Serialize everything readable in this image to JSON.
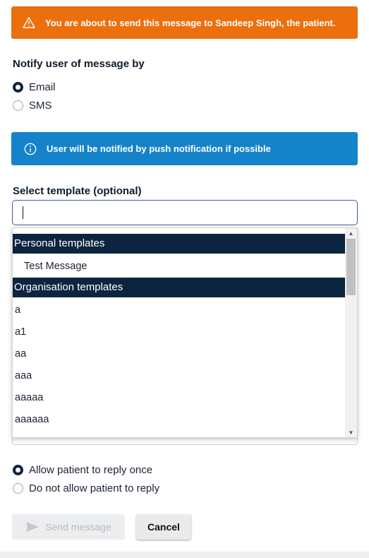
{
  "warning": {
    "text": "You are about to send this message to Sandeep Singh, the patient.",
    "icon": "warning-triangle-icon"
  },
  "notify": {
    "heading": "Notify user of message by",
    "options": [
      {
        "label": "Email",
        "selected": true
      },
      {
        "label": "SMS",
        "selected": false
      }
    ]
  },
  "info": {
    "text": "User will be notified by push notification if possible",
    "icon": "info-circle-icon"
  },
  "template": {
    "heading": "Select template (optional)",
    "input_value": "",
    "groups": [
      {
        "label": "Personal templates",
        "items": [
          "Test Message"
        ]
      },
      {
        "label": "Organisation templates",
        "items": [
          "a",
          "a1",
          "aa",
          "aaa",
          "aaaaa",
          "aaaaaa"
        ]
      }
    ]
  },
  "reply": {
    "options": [
      {
        "label": "Allow patient to reply once",
        "selected": true
      },
      {
        "label": "Do not allow patient to reply",
        "selected": false
      }
    ]
  },
  "actions": {
    "send_label": "Send message",
    "cancel_label": "Cancel"
  },
  "colors": {
    "warning": "#ec6f0e",
    "info": "#1583c9",
    "navy": "#0b2440"
  }
}
